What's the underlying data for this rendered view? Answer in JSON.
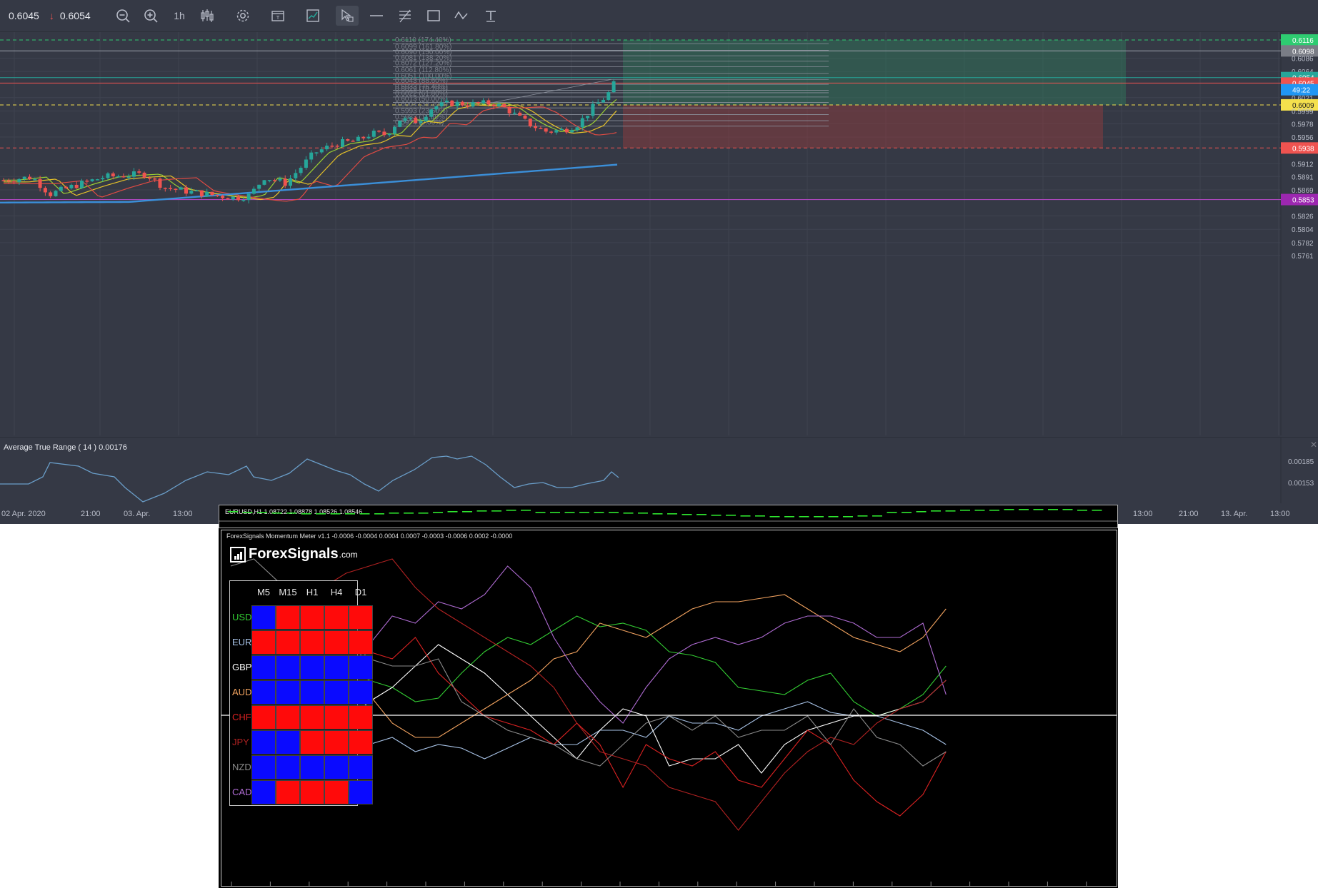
{
  "toolbar": {
    "price_current": "0.6045",
    "price_change_icon": "down-arrow-icon",
    "price_previous": "0.6054",
    "timeframe": "1h",
    "icons": [
      "zoom-out-icon",
      "zoom-in-icon",
      "timeframe",
      "candlestick-icon",
      "settings-icon",
      "template-icon",
      "chart-indicator-icon",
      "cursor-tool-icon",
      "horizontal-line-icon",
      "fib-tool-icon",
      "rectangle-tool-icon",
      "path-tool-icon",
      "text-tool-icon"
    ]
  },
  "price_axis": {
    "labels": [
      "0.6116",
      "0.6098",
      "0.6086",
      "0.6064",
      "0.6054",
      "0.6045",
      "49:22",
      "0.6021",
      "0.6009",
      "0.5999",
      "0.5978",
      "0.5956",
      "0.5938",
      "0.5912",
      "0.5891",
      "0.5869",
      "0.5853",
      "0.5826",
      "0.5804",
      "0.5782",
      "0.5761"
    ],
    "badges": {
      "take_profit": {
        "text": "0.6116",
        "color": "#2ecc71"
      },
      "last_close": {
        "text": "0.6098",
        "color": "#7a7d86"
      },
      "bid": {
        "text": "0.6054",
        "color": "#26a69a"
      },
      "ask": {
        "text": "0.6045",
        "color": "#ef5350"
      },
      "countdown": {
        "text": "49:22",
        "color": "#2196f3"
      },
      "entry": {
        "text": "0.6009",
        "color": "#f4e04d"
      },
      "stop_loss": {
        "text": "0.5938",
        "color": "#ef5350"
      },
      "alert": {
        "text": "0.5853",
        "color": "#9c27b0"
      }
    }
  },
  "fib_levels": [
    "0.6110 (174.40%)",
    "0.6099 (161.80%)",
    "0.6090 (150.00%)",
    "0.6081 (138.20%)",
    "0.6072 (127.20%)",
    "0.6061 (112.80%)",
    "0.6051 (100.00%)",
    "0.6043 (88.60%)",
    "0.6033 (76.40%)",
    "0.6029 (70.70%)",
    "0.6022 (61.80%)",
    "0.6013 (50.00%)",
    "0.6004 (38.20%)",
    "0.5993 (23.60%)",
    "0.5983 (11.40%)",
    "0.5974 (0.00%)"
  ],
  "atr": {
    "title": "Average True Range ( 14 ) 0.00176",
    "axis_labels": [
      "0.00185",
      "0.00153"
    ]
  },
  "time_axis": [
    "02 Apr. 2020",
    "21:00",
    "03. Apr.",
    "13:00",
    "13:00",
    "21:00",
    "13. Apr.",
    "13:00"
  ],
  "mt4_top": {
    "label": "EURUSD,H1  1.08722 1.08878 1.08526 1.08546"
  },
  "momentum_meter": {
    "title": "ForexSignals Momentum Meter v1.1 -0.0006 -0.0004 0.0004 0.0007 -0.0003 -0.0006 0.0002 -0.0000",
    "brand_main": "ForexSignals",
    "brand_suffix": ".com",
    "columns": [
      "M5",
      "M15",
      "H1",
      "H4",
      "D1"
    ],
    "rows": [
      {
        "name": "USD",
        "color": "#33cc33",
        "cells": [
          "blue",
          "red",
          "red",
          "red",
          "red"
        ]
      },
      {
        "name": "EUR",
        "color": "#a9c4e8",
        "cells": [
          "red",
          "red",
          "red",
          "red",
          "red"
        ]
      },
      {
        "name": "GBP",
        "color": "#ffffff",
        "cells": [
          "blue",
          "blue",
          "blue",
          "blue",
          "blue"
        ]
      },
      {
        "name": "AUD",
        "color": "#f4a460",
        "cells": [
          "blue",
          "blue",
          "blue",
          "blue",
          "blue"
        ]
      },
      {
        "name": "CHF",
        "color": "#dd2222",
        "cells": [
          "red",
          "red",
          "red",
          "red",
          "red"
        ]
      },
      {
        "name": "JPY",
        "color": "#b22222",
        "cells": [
          "blue",
          "blue",
          "red",
          "red",
          "red"
        ]
      },
      {
        "name": "NZD",
        "color": "#8c8c8c",
        "cells": [
          "blue",
          "blue",
          "blue",
          "blue",
          "blue"
        ]
      },
      {
        "name": "CAD",
        "color": "#b06cd4",
        "cells": [
          "blue",
          "red",
          "red",
          "red",
          "blue"
        ]
      }
    ]
  },
  "colors": {
    "chart_bg": "#353945",
    "bull": "#26a69a",
    "bear": "#ef5350",
    "ma_fast": "#9acd32",
    "ma_mid": "#e6c229",
    "ma_slow": "#e04b43",
    "ma_long": "#3b8fd9",
    "tp_zone": "rgba(46,125,90,0.45)",
    "sl_zone": "rgba(150,60,60,0.45)",
    "cell_red": "#ff0a0a",
    "cell_blue": "#0a0aff"
  }
}
